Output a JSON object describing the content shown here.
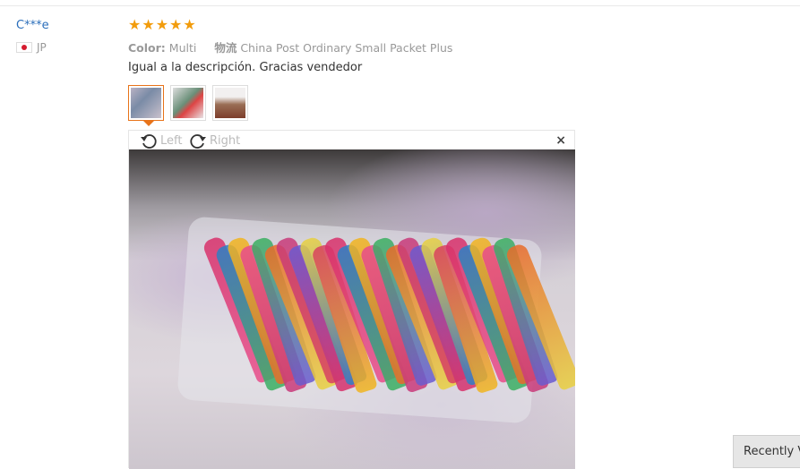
{
  "review": {
    "user_name": "C***e",
    "country_code": "JP",
    "rating": 5,
    "attributes": {
      "color_label": "Color:",
      "color_value": "Multi",
      "shipping_label": "物流",
      "shipping_value": "China Post Ordinary Small Packet Plus"
    },
    "text": "Igual a la descripción. Gracias vendedor",
    "thumbnails": [
      {
        "alt": "review photo 1"
      },
      {
        "alt": "review photo 2"
      },
      {
        "alt": "review photo 3"
      }
    ],
    "active_thumbnail": 1
  },
  "viewer": {
    "rotate_left_label": "Left",
    "rotate_right_label": "Right",
    "close_symbol": "×"
  },
  "recently_viewed": {
    "label": "Recently V"
  },
  "colors": {
    "link": "#2a6ebb",
    "star": "#f29c0c",
    "active_border": "#e8731a"
  }
}
